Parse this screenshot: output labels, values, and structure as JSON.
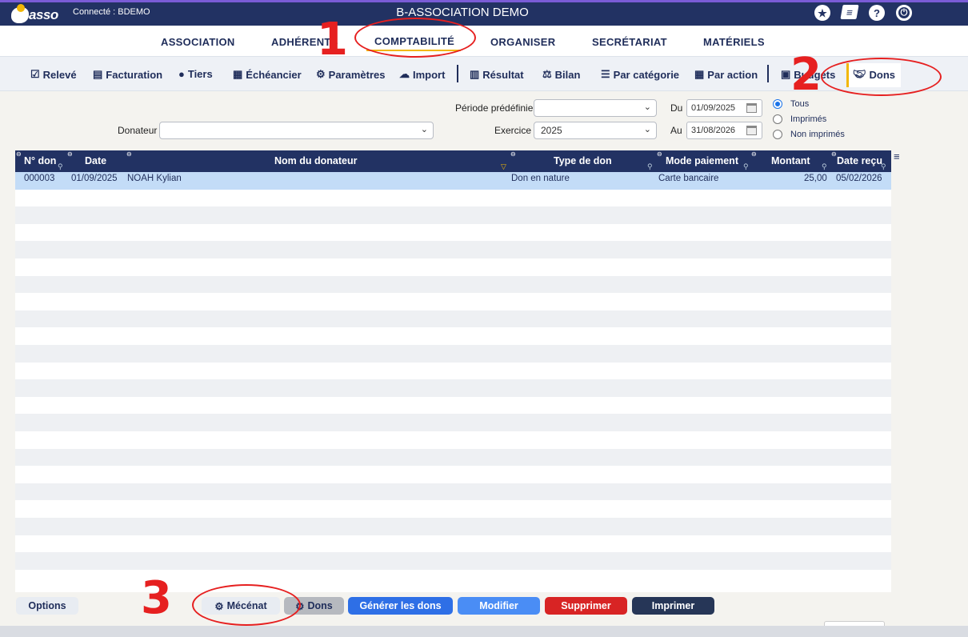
{
  "topbar": {
    "logo_text": "asso",
    "connected": "Connecté : BDEMO",
    "title": "B-ASSOCIATION DEMO",
    "icons": [
      "star-icon",
      "book-icon",
      "help-icon",
      "power-icon"
    ]
  },
  "mainmenu": {
    "items": [
      "ASSOCIATION",
      "ADHÉRENTS",
      "COMPTABILITÉ",
      "ORGANISER",
      "SECRÉTARIAT",
      "MATÉRIELS"
    ],
    "active": "COMPTABILITÉ"
  },
  "submenu": {
    "items": [
      "Relevé",
      "Facturation",
      "Tiers",
      "Échéancier",
      "Paramètres",
      "Import",
      "Résultat",
      "Bilan",
      "Par catégorie",
      "Par action",
      "Budgets",
      "Dons"
    ],
    "active": "Dons"
  },
  "filters": {
    "periode_label": "Période prédéfinie",
    "periode_value": "",
    "exercice_label": "Exercice",
    "exercice_value": "2025",
    "donateur_label": "Donateur",
    "donateur_value": "",
    "du_label": "Du",
    "du_value": "01/09/2025",
    "au_label": "Au",
    "au_value": "31/08/2026",
    "radio_options": [
      "Tous",
      "Imprimés",
      "Non imprimés"
    ],
    "radio_selected": "Tous"
  },
  "table": {
    "columns": [
      "N° don",
      "Date",
      "Nom du donateur",
      "Type de don",
      "Mode paiement",
      "Montant",
      "Date reçu"
    ],
    "rows": [
      {
        "num": "000003",
        "date": "01/09/2025",
        "donateur": "NOAH Kylian",
        "type": "Don en nature",
        "mode": "Carte bancaire",
        "montant": "25,00",
        "date_recu": "05/02/2026"
      }
    ]
  },
  "buttons": {
    "options": "Options",
    "mecenat": "Mécénat",
    "dons": "Dons",
    "generer": "Générer les dons",
    "modifier": "Modifier",
    "supprimer": "Supprimer",
    "imprimer": "Imprimer"
  },
  "annotations": {
    "one": "1",
    "two": "2",
    "three": "3",
    "color": "#e62020"
  },
  "colors": {
    "navy": "#223263",
    "accent": "#f2b705",
    "selected_row": "#c3dcf7",
    "blue_button": "#2e6fe6",
    "red_button": "#d82424"
  }
}
